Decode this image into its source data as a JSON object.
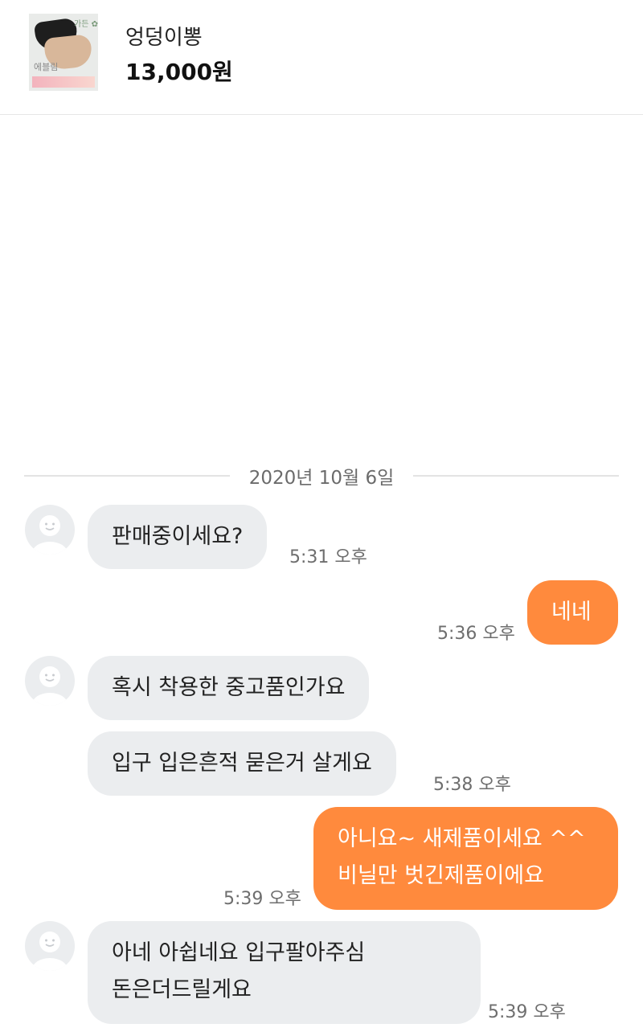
{
  "header": {
    "product_name": "엉덩이뽕",
    "price": "13,000원",
    "thumbnail_icon": "product-photo-icon",
    "thumbnail_text": "에블림",
    "thumbnail_deco": "가든 ✿"
  },
  "date_separator": "2020년 10월 6일",
  "messages": [
    {
      "side": "in",
      "lines": [
        "판매중이세요?"
      ],
      "time": "5:31 오후"
    },
    {
      "side": "out",
      "lines": [
        "네네"
      ],
      "time": "5:36 오후"
    },
    {
      "side": "in",
      "lines": [
        "혹시 착용한 중고품인가요"
      ],
      "time": ""
    },
    {
      "side": "in",
      "lines": [
        "입구 입은흔적 묻은거 살게요"
      ],
      "time": "5:38 오후"
    },
    {
      "side": "out",
      "lines": [
        "아니요~ 새제품이세요 ^^",
        "비닐만 벗긴제품이에요"
      ],
      "time": "5:39 오후"
    },
    {
      "side": "in",
      "lines": [
        "아네 아쉽네요 입구팔아주심",
        "돈은더드릴게요"
      ],
      "time": "5:39 오후"
    }
  ],
  "colors": {
    "outgoing_bubble": "#ff8a3d",
    "incoming_bubble": "#ebedef",
    "avatar_bg": "#ebedef"
  }
}
